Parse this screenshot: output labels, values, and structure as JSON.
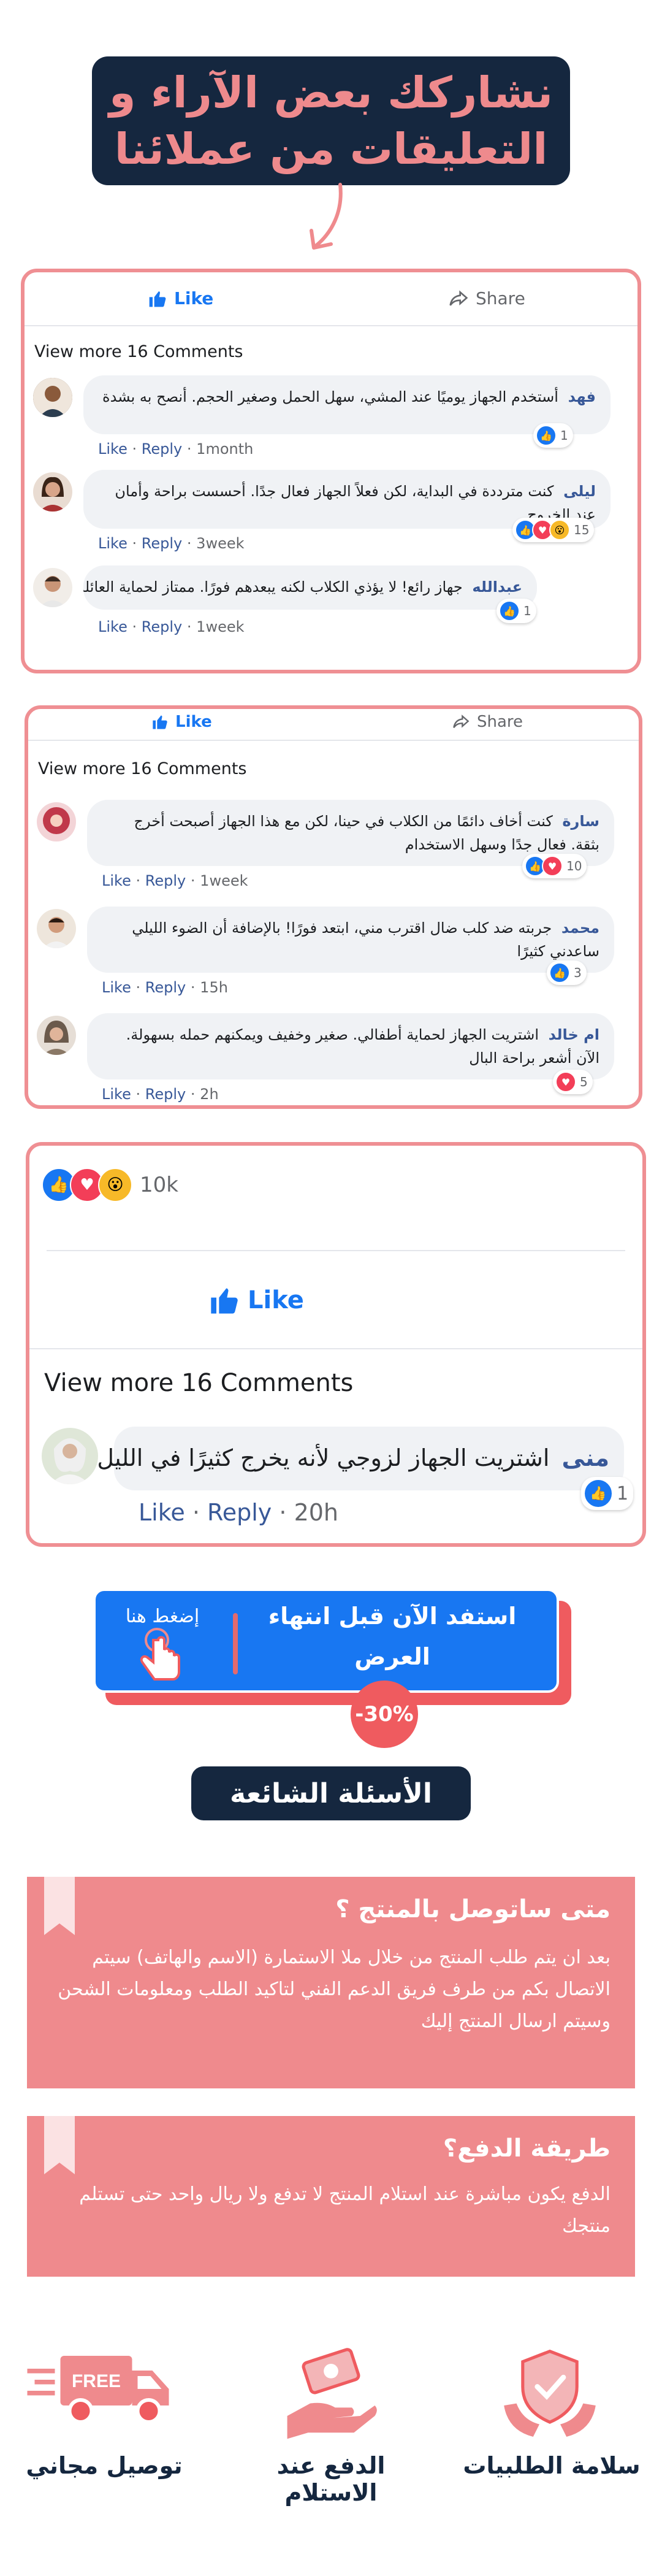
{
  "header": {
    "line1": "نشاركك بعض الآراء و",
    "line2": "التعليقات من عملائنا"
  },
  "fb": {
    "like": "Like",
    "share": "Share",
    "reply": "Reply",
    "dot": "·"
  },
  "card1": {
    "view_more": "View more 16 Comments",
    "comments": [
      {
        "name": "فهد",
        "text": "أستخدم الجهاز يوميًا عند المشي، سهل الحمل وصغير الحجم. أنصح به بشدة",
        "time": "1month",
        "reactions": "1"
      },
      {
        "name": "ليلى",
        "text": "كنت مترددة في البداية، لكن فعلاً الجهاز فعال جدًا. أحسست براحة وأمان عند الخروج",
        "time": "3week",
        "reactions": "15"
      },
      {
        "name": "عبدالله",
        "text": "جهاز رائع! لا يؤذي الكلاب لكنه يبعدهم فورًا. ممتاز لحماية العائلة",
        "time": "1week",
        "reactions": "1"
      }
    ]
  },
  "card2": {
    "view_more": "View more 16 Comments",
    "comments": [
      {
        "name": "سارة",
        "text": "كنت أخاف دائمًا من الكلاب في حينا، لكن مع هذا الجهاز أصبحت أخرج بثقة. فعال جدًا وسهل الاستخدام",
        "time": "1week",
        "reactions": "10"
      },
      {
        "name": "محمد",
        "text": "جربته ضد كلب ضال اقترب مني، ابتعد فورًا! بالإضافة أن الضوء الليلي ساعدني كثيرًا",
        "time": "15h",
        "reactions": "3"
      },
      {
        "name": "ام خالد",
        "text": "اشتريت الجهاز لحماية أطفالي. صغير وخفيف ويمكنهم حمله بسهولة. الآن أشعر براحة البال",
        "time": "2h",
        "reactions": "5"
      }
    ]
  },
  "card3": {
    "reaction_count": "10k",
    "view_more": "View more 16 Comments",
    "comment": {
      "name": "منى",
      "text": "اشتريت الجهاز لزوجي لأنه يخرج كثيرًا في الليل",
      "time": "20h",
      "reactions": "1"
    }
  },
  "cta": {
    "main": "استفد الآن قبل انتهاء العرض",
    "click": "إضغط هنا",
    "discount": "-30%"
  },
  "faq": {
    "title": "الأسئلة الشائعة",
    "items": [
      {
        "q": "متى ساتوصل بالمنتج ؟",
        "a": "بعد ان يتم طلب المنتج من خلال ملا الاستمارة (الاسم والهاتف) سيتم الاتصال بكم من طرف فريق الدعم الفني لتاكيد الطلب ومعلومات الشحن وسيتم ارسال المنتج إليك"
      },
      {
        "q": "طريقة الدفع؟",
        "a": "الدفع يكون مباشرة عند استلام المنتج لا تدفع ولا ريال واحد حتى تستلم منتجك"
      }
    ]
  },
  "features": [
    {
      "label": "سلامة الطلبيات",
      "icon": "shield-hands-icon"
    },
    {
      "label": "الدفع عند الاستلام",
      "icon": "cash-hand-icon"
    },
    {
      "label": "توصيل مجاني",
      "icon": "delivery-truck-icon",
      "truck_text": "FREE"
    }
  ],
  "colors": {
    "accent": "#ef8a8d",
    "navy": "#15273f",
    "fb_blue": "#1877f2",
    "cta_red": "#ef5b5f"
  }
}
